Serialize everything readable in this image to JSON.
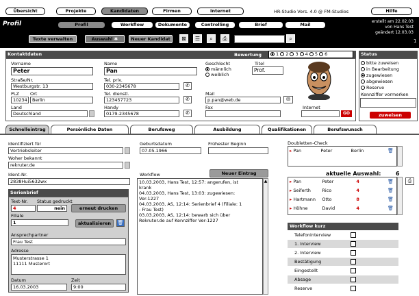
{
  "top_tabs": [
    "Übersicht",
    "Projekte",
    "Kandidaten",
    "Firmen",
    "Internet",
    "Hilfe"
  ],
  "version": "HR-Studio Vers. 4.0 @ FM-Studios",
  "profile_title": "Profil",
  "sub_tabs": [
    "Profil",
    "Workflow",
    "Dokumente",
    "Controlling",
    "Brief",
    "Mail"
  ],
  "created_info": [
    "erstellt am 22.02.03",
    "von Hans Test",
    "geändert 12.03.03"
  ],
  "page_number": "1",
  "toolbar": {
    "texte_verwalten": "Texte verwalten",
    "auswahl": "Auswahl",
    "neuer_kandidat": "Neuer Kandidat"
  },
  "kontakt": {
    "header": "Kontaktdaten",
    "bewertung_label": "Bewertung",
    "bewertung_opts": [
      "1",
      "2",
      "3",
      "4",
      "5",
      "6"
    ],
    "vorname_label": "Vorname",
    "vorname": "Peter",
    "name_label": "Name",
    "name": "Pan",
    "geschlecht_label": "Geschlecht",
    "maennlich": "männlich",
    "weiblich": "weiblich",
    "titel_label": "Titel",
    "titel": "Prof.",
    "strasse_label": "Straße/Nr.",
    "strasse": "Westburgstr. 13",
    "tel_priv_label": "Tel. priv.",
    "tel_priv": "030-2345678",
    "plz_label": "PLZ",
    "ort_label": "Ort",
    "plz": "10234",
    "ort": "Berlin",
    "tel_dienstl_label": "Tel. dienstl.",
    "tel_dienstl": "123457723",
    "mail_label": "Mail",
    "mail": "p.pan@web.de",
    "land_label": "Land",
    "land": "Deutschland",
    "handy_label": "Handy",
    "handy": "0179-2345678",
    "fax_label": "Fax",
    "fax": "",
    "internet_label": "Internet",
    "go": "GO"
  },
  "status": {
    "header": "Status",
    "options": [
      "bitte zuweisen",
      "in Bearbeitung",
      "zugewiesen",
      "abgewiesen",
      "Reserve"
    ],
    "selected_index": 2,
    "kennziffer_label": "Kennziffer vormerken",
    "zuweisen": "zuweisen"
  },
  "bottom_tabs": [
    "Schnelleintrag",
    "Persönliche Daten",
    "Berufsweg",
    "Ausbildung",
    "Qualifikationen",
    "Berufswunsch"
  ],
  "schnell": {
    "identifiziert_label": "identifiziert für",
    "identifiziert": "Vertriebsleiter",
    "woher_label": "Woher bekannt",
    "woher": "rekruter.de",
    "ident_label": "Ident-Nr.",
    "ident": "2838Hui5632wx",
    "geburtsdatum_label": "Geburtsdatum",
    "geburtsdatum": "07.05.1966",
    "fruehester_label": "Frühester Beginn",
    "fruehester": ""
  },
  "serienbrief": {
    "header": "Serienbrief",
    "textnr_label": "Text-Nr.",
    "textnr": "4",
    "status_label": "Status gedruckt",
    "status": "nein",
    "erneut": "erneut drucken",
    "filiale_label": "Filiale",
    "filiale": "1",
    "aktualisieren": "aktualisieren",
    "ansprech_label": "Ansprechpartner",
    "ansprech": "Frau Test",
    "adresse_label": "Adresse",
    "adresse": [
      "Musterstrasse 1",
      "11111 Musterort"
    ],
    "datum_label": "Datum",
    "datum": "16.03.2003",
    "zeit_label": "Zeit",
    "zeit": "9:00"
  },
  "workflow": {
    "label": "Workflow",
    "neuer_eintrag": "Neuer Eintrag",
    "entries": [
      "10.03.2003, Hans Test, 12:57: angerufen, ist",
      "krank",
      "04.03.2003, Hans Test, 13:03: zugewiesen:",
      "Ver-1227",
      "04.03.2003, AS, 12:14: Serienbrief 4 (Filiale: 1",
      "- Frau Test)",
      "03.03.2003, AS, 12:14: bewarb sich über",
      "Rekruter.de auf Kennziffer Ver-1227"
    ]
  },
  "doubletten": {
    "label": "Doubletten-Check",
    "rows": [
      {
        "name": "Pan",
        "vorname": "Peter",
        "ort": "Berlin"
      }
    ]
  },
  "auswahl": {
    "label": "aktuelle Auswahl:",
    "count": "6",
    "rows": [
      {
        "name": "Pan",
        "vorname": "Peter",
        "num": "4"
      },
      {
        "name": "Seiferth",
        "vorname": "Rico",
        "num": "4"
      },
      {
        "name": "Hartmann",
        "vorname": "Otto",
        "num": "8"
      },
      {
        "name": "Höhne",
        "vorname": "David",
        "num": "4"
      }
    ]
  },
  "workflow_kurz": {
    "header": "Workflow kurz",
    "items": [
      "Telefoninterview",
      "1. Interview",
      "2. Interview",
      "Bestätigung",
      "Eingestellt",
      "Absage",
      "Reserve"
    ]
  },
  "colors": {
    "accent_red": "#c00000",
    "dark_bg": "#000000",
    "grey_tab": "#8a8a8a"
  }
}
